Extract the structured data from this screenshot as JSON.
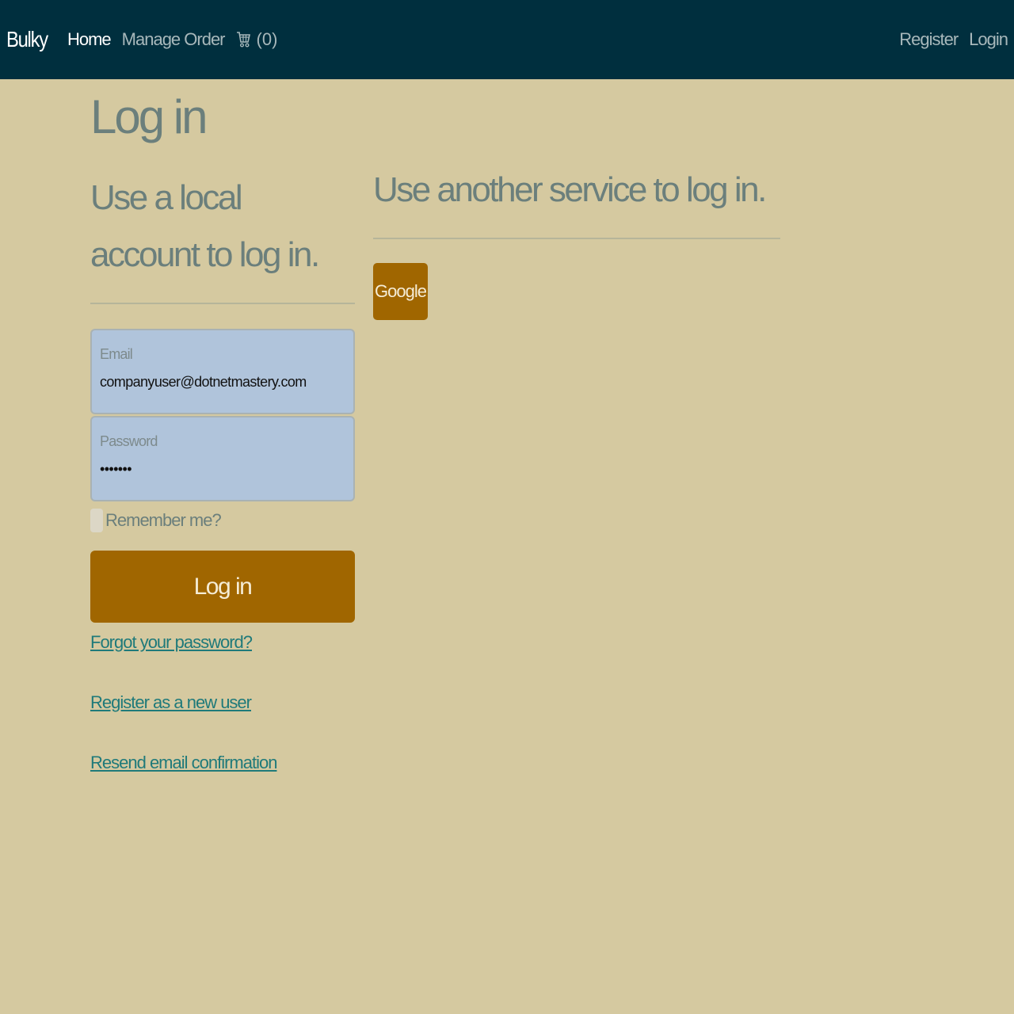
{
  "navbar": {
    "brand": "Bulky",
    "links": [
      "Home",
      "Manage Order"
    ],
    "cart_count": "(0)",
    "cart_icon": "cart-icon",
    "right_links": [
      "Register",
      "Login"
    ],
    "background": "#002f3e"
  },
  "page": {
    "title": "Log in",
    "background": "#d5c9a0"
  },
  "local_login": {
    "heading": "Use a local account to log in.",
    "email": {
      "label": "Email",
      "value": "companyuser@dotnetmastery.com"
    },
    "password": {
      "label": "Password",
      "value": "•••••••"
    },
    "remember_label": "Remember me?",
    "remember_checked": false,
    "submit_label": "Log in",
    "links": {
      "forgot": "Forgot your password?",
      "register": "Register as a new user",
      "resend": "Resend email confirmation"
    }
  },
  "external_login": {
    "heading": "Use another service to log in.",
    "providers": [
      "Google"
    ]
  },
  "colors": {
    "accent": "#a06600",
    "link": "#1f7a7a",
    "input_bg": "#b0c4db"
  }
}
